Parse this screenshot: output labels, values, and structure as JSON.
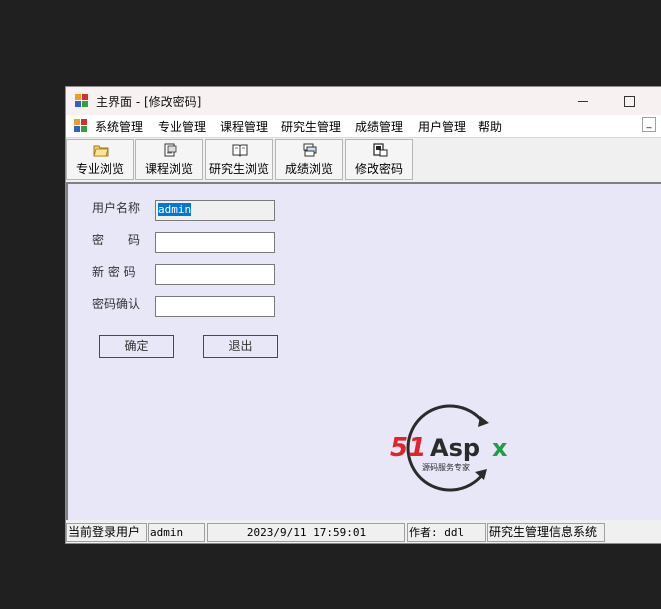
{
  "window": {
    "title": "主界面 - [修改密码]",
    "minimize_glyph": "—",
    "mdi_minimize_glyph": "_"
  },
  "menu": {
    "items": [
      "系统管理",
      "专业管理",
      "课程管理",
      "研究生管理",
      "成绩管理",
      "用户管理",
      "帮助"
    ]
  },
  "toolbar": {
    "buttons": [
      {
        "label": "专业浏览",
        "icon": "folder-icon"
      },
      {
        "label": "课程浏览",
        "icon": "document-icon"
      },
      {
        "label": "研究生浏览",
        "icon": "book-icon"
      },
      {
        "label": "成绩浏览",
        "icon": "records-icon"
      },
      {
        "label": "修改密码",
        "icon": "key-doc-icon"
      }
    ]
  },
  "form": {
    "username_label": "用户名称",
    "username_value": "admin",
    "password_label": "密　　码",
    "new_password_label": "新 密 码",
    "confirm_label": "密码确认",
    "ok_button": "确定",
    "exit_button": "退出"
  },
  "logo": {
    "brand_51": "51",
    "brand_aspx": "Aspx",
    "tagline": "源码服务专家",
    "colors": {
      "red": "#e0242a",
      "green": "#1e9e4a",
      "dark": "#2b2b2b"
    }
  },
  "status": {
    "login_label": "当前登录用户",
    "user": "admin",
    "datetime": "2023/9/11 17:59:01",
    "author": "作者: ddl",
    "system_name": "研究生管理信息系统"
  }
}
